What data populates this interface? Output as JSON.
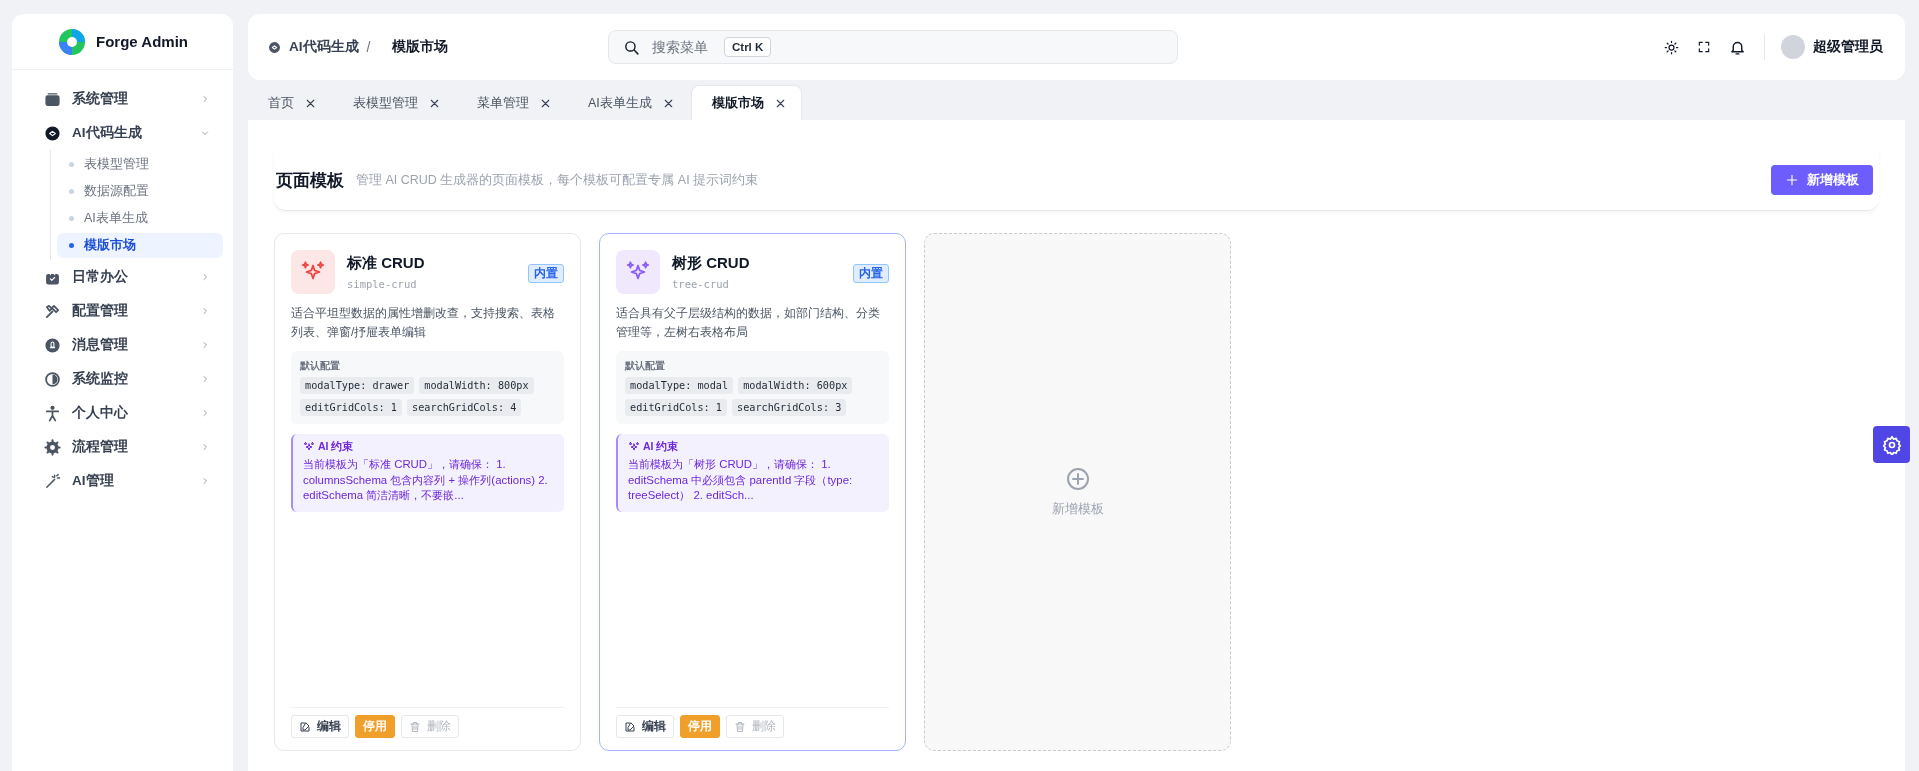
{
  "sidebar": {
    "logo_text": "Forge Admin",
    "items": [
      {
        "label": "系统管理",
        "expanded": false
      },
      {
        "label": "AI代码生成",
        "expanded": true,
        "children": [
          {
            "label": "表模型管理",
            "selected": false
          },
          {
            "label": "数据源配置",
            "selected": false
          },
          {
            "label": "AI表单生成",
            "selected": false
          },
          {
            "label": "模版市场",
            "selected": true
          }
        ]
      },
      {
        "label": "日常办公",
        "expanded": false
      },
      {
        "label": "配置管理",
        "expanded": false
      },
      {
        "label": "消息管理",
        "expanded": false
      },
      {
        "label": "系统监控",
        "expanded": false
      },
      {
        "label": "个人中心",
        "expanded": false
      },
      {
        "label": "流程管理",
        "expanded": false
      },
      {
        "label": "AI管理",
        "expanded": false
      }
    ]
  },
  "header": {
    "breadcrumb": [
      "AI代码生成",
      "模版市场"
    ],
    "separator": "/",
    "search": {
      "placeholder": "搜索菜单",
      "shortcut": "Ctrl K"
    },
    "user": "超级管理员"
  },
  "tabs": [
    {
      "label": "首页",
      "selected": false
    },
    {
      "label": "表模型管理",
      "selected": false
    },
    {
      "label": "菜单管理",
      "selected": false
    },
    {
      "label": "AI表单生成",
      "selected": false
    },
    {
      "label": "模版市场",
      "selected": true
    }
  ],
  "page": {
    "title": "页面模板",
    "subtitle": "管理 AI CRUD 生成器的页面模板，每个模板可配置专属 AI 提示词约束",
    "add_button": "新增模板"
  },
  "templates": [
    {
      "name": "标准 CRUD",
      "code": "simple-crud",
      "badge": "内置",
      "color": "#ef4444",
      "selected": false,
      "description": "适合平坦型数据的属性增删改查，支持搜索、表格列表、弹窗/抒屉表单编辑",
      "config_label": "默认配置",
      "config": [
        "modalType: drawer",
        "modalWidth: 800px",
        "editGridCols: 1",
        "searchGridCols: 4"
      ],
      "ai_label": "AI 约束",
      "ai_text": "当前模板为「标准 CRUD」，请确保： 1. columnsSchema 包含内容列 + 操作列(actions) 2. editSchema 简洁清晰，不要嵌...",
      "actions": [
        {
          "kind": "edit",
          "label": "编辑",
          "disabled": false
        },
        {
          "kind": "toggle",
          "label": "停用",
          "disabled": false
        },
        {
          "kind": "delete",
          "label": "删除",
          "disabled": true
        }
      ]
    },
    {
      "name": "树形 CRUD",
      "code": "tree-crud",
      "badge": "内置",
      "color": "#8b5cf6",
      "selected": true,
      "description": "适合具有父子层级结构的数据，如部门结构、分类管理等，左树右表格布局",
      "config_label": "默认配置",
      "config": [
        "modalType: modal",
        "modalWidth: 600px",
        "editGridCols: 1",
        "searchGridCols: 3"
      ],
      "ai_label": "AI 约束",
      "ai_text": "当前模板为「树形 CRUD」，请确保： 1. editSchema 中必须包含 parentId 字段（type: treeSelect） 2. editSch...",
      "actions": [
        {
          "kind": "edit",
          "label": "编辑",
          "disabled": false
        },
        {
          "kind": "toggle",
          "label": "停用",
          "disabled": false
        },
        {
          "kind": "delete",
          "label": "删除",
          "disabled": true
        }
      ]
    }
  ],
  "add_card": {
    "label": "新增模板"
  }
}
